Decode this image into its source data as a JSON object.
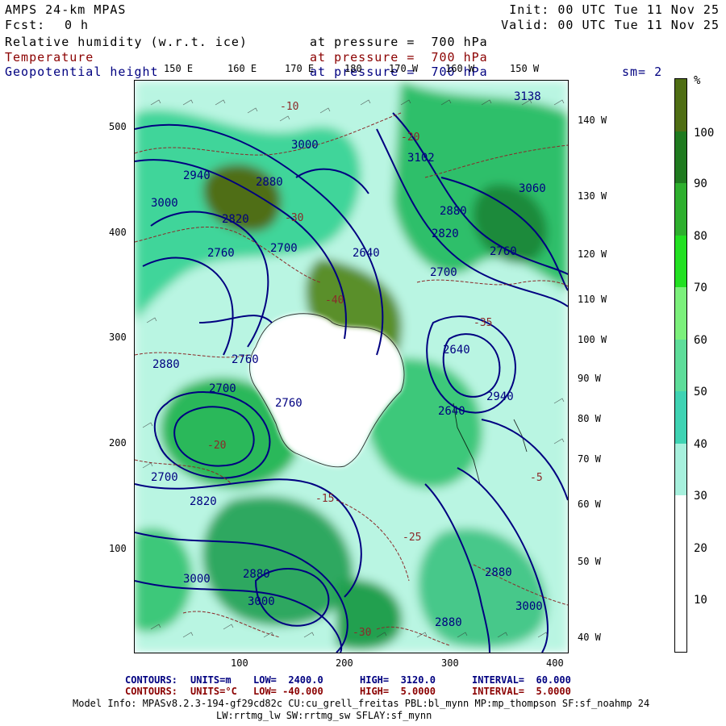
{
  "header": {
    "model": "AMPS 24-km MPAS",
    "fcst_label": "Fcst:",
    "fcst_value": "0 h",
    "init": "Init: 00 UTC Tue 11 Nov 25",
    "valid": "Valid: 00 UTC Tue 11 Nov 25",
    "smoothing": "sm= 2"
  },
  "fields": [
    {
      "name": "Relative humidity (w.r.t. ice)",
      "level": "at pressure =  700 hPa",
      "color": "#000000"
    },
    {
      "name": "Temperature",
      "level": "at pressure =  700 hPa",
      "color": "#8b0000"
    },
    {
      "name": "Geopotential height",
      "level": "at pressure =  700 hPa",
      "color": "#000080"
    }
  ],
  "map": {
    "top_lon_labels": [
      "150 E",
      "160 E",
      "170 E",
      "180",
      "170 W",
      "160 W",
      "150 W"
    ],
    "right_lon_labels": [
      "140 W",
      "130 W",
      "120 W",
      "110 W",
      "100 W",
      "90 W",
      "80 W",
      "70 W",
      "60 W",
      "50 W",
      "40 W"
    ],
    "y_grid_labels": [
      "500",
      "400",
      "300",
      "200",
      "100"
    ],
    "x_grid_labels": [
      "100",
      "200",
      "300",
      "400"
    ],
    "height_contour_labels": [
      "3138",
      "3102",
      "3060",
      "3000",
      "2940",
      "2880",
      "2820",
      "2760",
      "2700",
      "2640",
      "3000",
      "2880",
      "2760",
      "2700",
      "2820",
      "3000",
      "2880",
      "2760",
      "2700",
      "2640",
      "2880",
      "2820",
      "2760",
      "2880",
      "3000",
      "2700",
      "2940",
      "2880",
      "3000",
      "2640"
    ],
    "temperature_contour_labels": [
      "-20",
      "-30",
      "-10",
      "-40",
      "-20",
      "-15",
      "-5",
      "-35",
      "-25",
      "-30"
    ]
  },
  "colorbar": {
    "unit": "%",
    "labels": [
      "100",
      "90",
      "80",
      "70",
      "60",
      "50",
      "40",
      "30",
      "20",
      "10"
    ],
    "colors": [
      "#4f6e14",
      "#1f7a1f",
      "#2eaf2e",
      "#22e022",
      "#7cf07c",
      "#5edd9a",
      "#3fd3b3",
      "#a7f0dd",
      "#ffffff",
      "#ffffff",
      "#ffffff"
    ]
  },
  "footer": {
    "line1": {
      "contours": "CONTOURS:",
      "units": "UNITS=m",
      "low": "LOW=  2400.0",
      "high": "HIGH=  3120.0",
      "interval": "INTERVAL=  60.000"
    },
    "line2": {
      "contours": "CONTOURS:",
      "units": "UNITS=°C",
      "low": "LOW= -40.000",
      "high": "HIGH=  5.0000",
      "interval": "INTERVAL=  5.0000"
    },
    "model_info": "Model Info: MPASv8.2.3-194-gf29cd82c CU:cu_grell_freitas PBL:bl_mynn MP:mp_thompson SF:sf_noahmp 24",
    "model_info2": "LW:rrtmg_lw SW:rrtmg_sw SFLAY:sf_mynn"
  }
}
